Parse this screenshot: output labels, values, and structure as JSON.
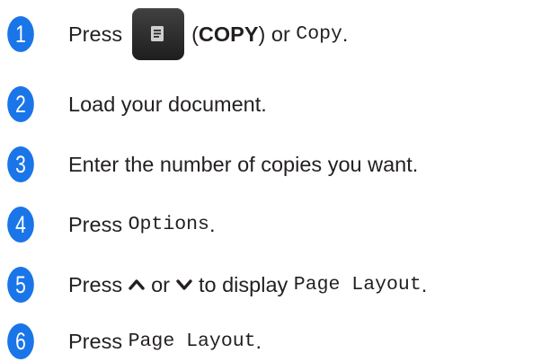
{
  "steps": [
    {
      "number": "1",
      "press": "Press",
      "copy_label": "COPY",
      "paren_open": "(",
      "paren_close": ") or",
      "copy_screen": "Copy",
      "end": "."
    },
    {
      "number": "2",
      "text": "Load your document."
    },
    {
      "number": "3",
      "text": "Enter the number of copies you want."
    },
    {
      "number": "4",
      "press": "Press",
      "button": "Options",
      "end": "."
    },
    {
      "number": "5",
      "press": "Press",
      "or": "or",
      "to_display": "to display",
      "button": "Page Layout",
      "end": "."
    },
    {
      "number": "6",
      "press": "Press",
      "button": "Page Layout",
      "end": "."
    }
  ],
  "icons": {
    "copy_button": "copy-document-icon",
    "up_arrow": "up-chevron-icon",
    "down_arrow": "down-chevron-icon"
  },
  "colors": {
    "step_number_bg": "#1a75e8",
    "step_number_fg": "#ffffff",
    "text": "#231f20",
    "copy_button_bg": "#2b2b2b"
  }
}
